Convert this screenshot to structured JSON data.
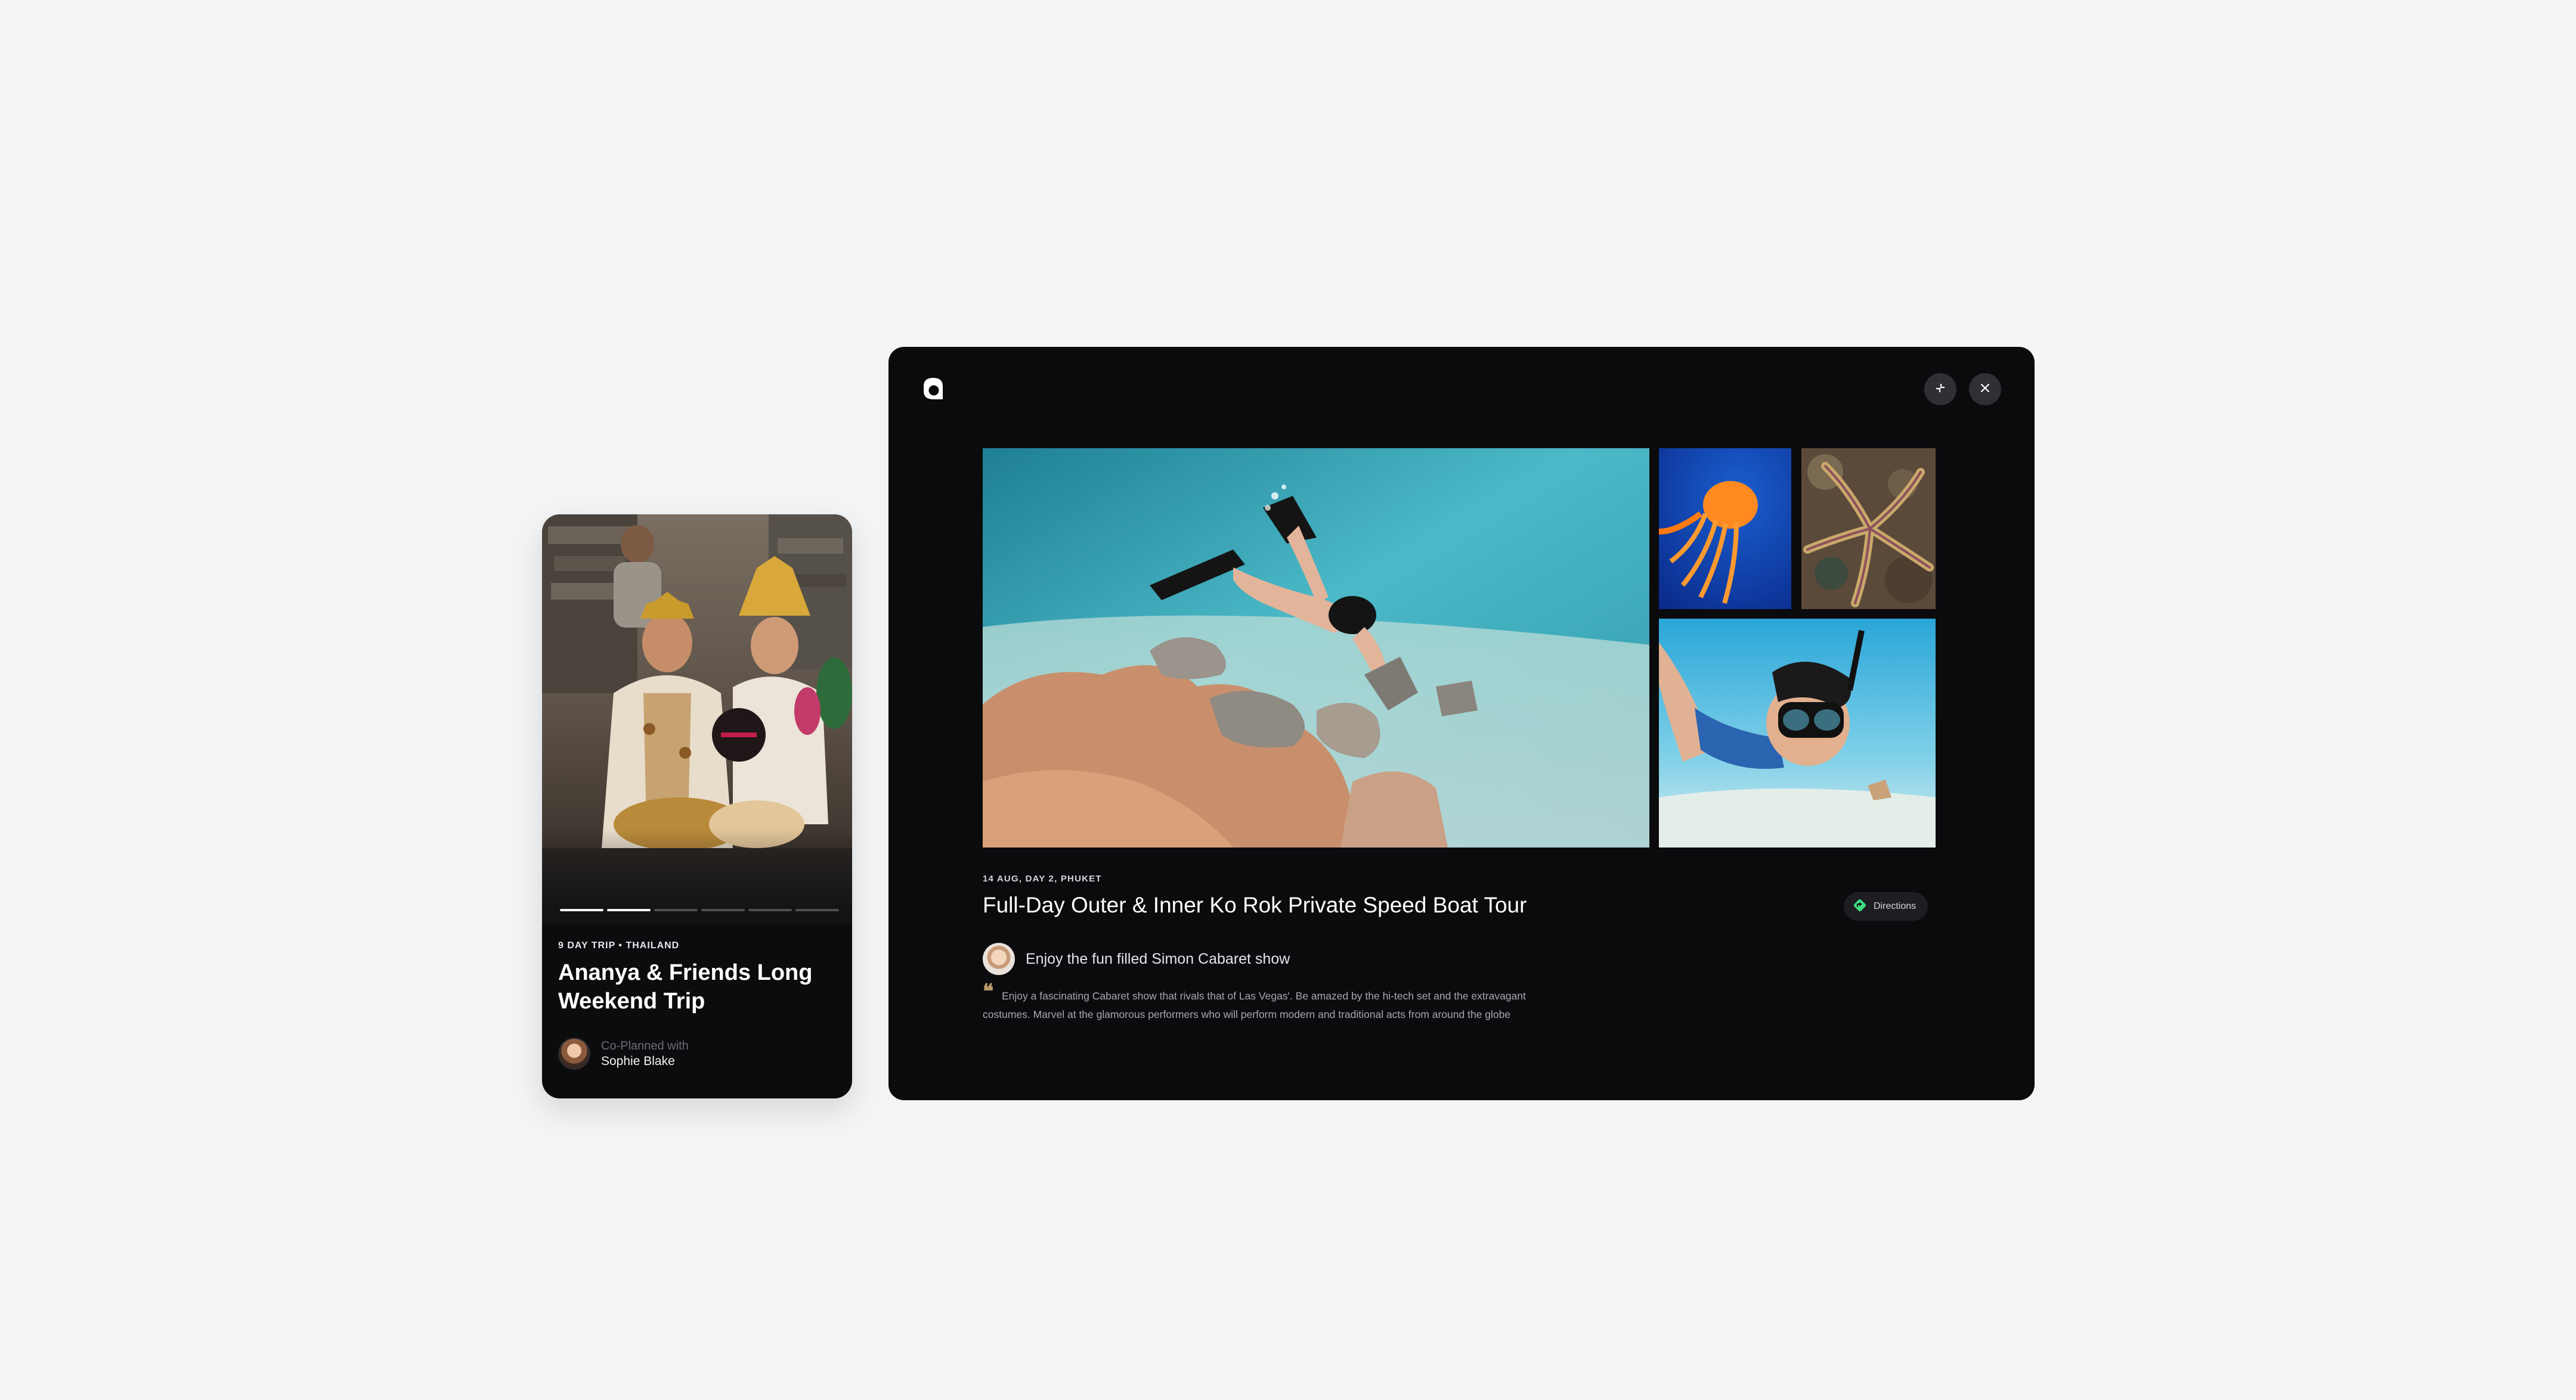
{
  "trip_card": {
    "eyebrow": "9 DAY TRIP • THAILAND",
    "title": "Ananya & Friends Long Weekend Trip",
    "planner_label": "Co-Planned with",
    "planner_name": "Sophie Blake",
    "progress": {
      "total": 6,
      "active_index": 1
    }
  },
  "modal": {
    "header": {
      "logo_icon": "brand-logo-icon",
      "collapse_icon": "collapse-arrows-icon",
      "close_icon": "close-icon"
    },
    "gallery": [
      {
        "name": "underwater-swimmer-photo"
      },
      {
        "name": "jellyfish-photo"
      },
      {
        "name": "starfish-photo"
      },
      {
        "name": "snorkeler-photo"
      }
    ],
    "eyebrow": "14 AUG, DAY 2, PHUKET",
    "title": "Full-Day Outer & Inner Ko Rok Private Speed Boat Tour",
    "directions_label": "Directions",
    "directions_icon": "directions-diamond-icon",
    "highlight_text": "Enjoy the fun filled Simon Cabaret show",
    "quote_mark": "❝",
    "description": "Enjoy a fascinating Cabaret show that rivals that of Las Vegas'. Be amazed by the hi-tech set and the extravagant costumes. Marvel at the glamorous performers who will perform modern and traditional acts from around the globe"
  },
  "colors": {
    "background": "#f3f4f6",
    "panel": "#0b0b0e",
    "accent_green": "#3ddc84",
    "quote_gold": "#b99a6a"
  }
}
